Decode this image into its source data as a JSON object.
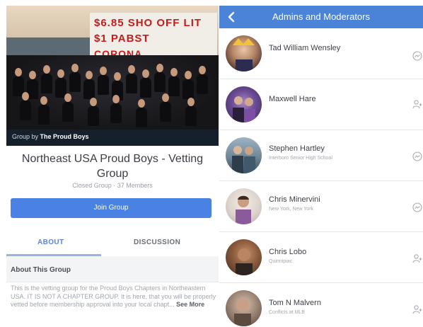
{
  "left_panel": {
    "cover_sign_lines": [
      "$6.85 SHO  OFF LIT",
      "$1 PABST",
      "CORONA"
    ],
    "cover_caption_prefix": "Group by",
    "cover_caption_owner": "The Proud Boys",
    "group_title": "Northeast USA Proud Boys - Vetting Group",
    "group_meta": "Closed Group · 37 Members",
    "join_button": "Join Group",
    "tabs": [
      {
        "label": "ABOUT",
        "active": true
      },
      {
        "label": "DISCUSSION",
        "active": false
      }
    ],
    "about_heading": "About This Group",
    "about_text": "This is the vetting group for the Proud Boys Chapters in Northeastern USA.  IT IS NOT A CHAPTER GROUP. It is here, that you will be properly vetted before membership approval into your local chapt...",
    "see_more": "See More"
  },
  "right_panel": {
    "title": "Admins and Moderators",
    "back_icon": "chevron-left-icon",
    "members": [
      {
        "name": "Tad William Wensley",
        "subtitle": "",
        "action_icon": "messenger-icon"
      },
      {
        "name": "Maxwell Hare",
        "subtitle": "",
        "action_icon": "add-friend-icon"
      },
      {
        "name": "Stephen Hartley",
        "subtitle": "Interboro Senior High School",
        "action_icon": "messenger-icon"
      },
      {
        "name": "Chris Minervini",
        "subtitle": "New York, New York",
        "action_icon": "messenger-icon"
      },
      {
        "name": "Chris Lobo",
        "subtitle": "Quinnipiac",
        "action_icon": "add-friend-icon"
      },
      {
        "name": "Tom N Malvern",
        "subtitle": "Conflicts at MLB",
        "action_icon": "add-friend-icon"
      }
    ]
  },
  "colors": {
    "nav_blue": "#4b83d9",
    "button_blue": "#4a82e3",
    "tab_active": "#5b84d8"
  }
}
